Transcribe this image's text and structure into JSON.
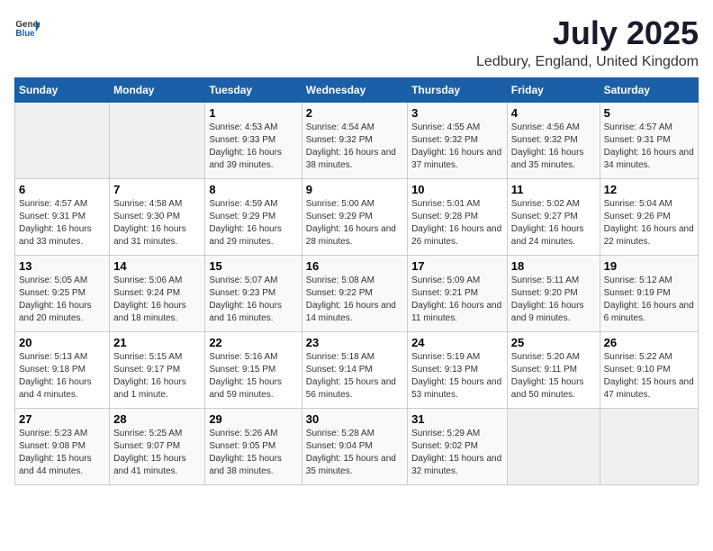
{
  "header": {
    "logo_general": "General",
    "logo_blue": "Blue",
    "title": "July 2025",
    "subtitle": "Ledbury, England, United Kingdom"
  },
  "days_of_week": [
    "Sunday",
    "Monday",
    "Tuesday",
    "Wednesday",
    "Thursday",
    "Friday",
    "Saturday"
  ],
  "weeks": [
    [
      {
        "day": "",
        "detail": ""
      },
      {
        "day": "",
        "detail": ""
      },
      {
        "day": "1",
        "detail": "Sunrise: 4:53 AM\nSunset: 9:33 PM\nDaylight: 16 hours and 39 minutes."
      },
      {
        "day": "2",
        "detail": "Sunrise: 4:54 AM\nSunset: 9:32 PM\nDaylight: 16 hours and 38 minutes."
      },
      {
        "day": "3",
        "detail": "Sunrise: 4:55 AM\nSunset: 9:32 PM\nDaylight: 16 hours and 37 minutes."
      },
      {
        "day": "4",
        "detail": "Sunrise: 4:56 AM\nSunset: 9:32 PM\nDaylight: 16 hours and 35 minutes."
      },
      {
        "day": "5",
        "detail": "Sunrise: 4:57 AM\nSunset: 9:31 PM\nDaylight: 16 hours and 34 minutes."
      }
    ],
    [
      {
        "day": "6",
        "detail": "Sunrise: 4:57 AM\nSunset: 9:31 PM\nDaylight: 16 hours and 33 minutes."
      },
      {
        "day": "7",
        "detail": "Sunrise: 4:58 AM\nSunset: 9:30 PM\nDaylight: 16 hours and 31 minutes."
      },
      {
        "day": "8",
        "detail": "Sunrise: 4:59 AM\nSunset: 9:29 PM\nDaylight: 16 hours and 29 minutes."
      },
      {
        "day": "9",
        "detail": "Sunrise: 5:00 AM\nSunset: 9:29 PM\nDaylight: 16 hours and 28 minutes."
      },
      {
        "day": "10",
        "detail": "Sunrise: 5:01 AM\nSunset: 9:28 PM\nDaylight: 16 hours and 26 minutes."
      },
      {
        "day": "11",
        "detail": "Sunrise: 5:02 AM\nSunset: 9:27 PM\nDaylight: 16 hours and 24 minutes."
      },
      {
        "day": "12",
        "detail": "Sunrise: 5:04 AM\nSunset: 9:26 PM\nDaylight: 16 hours and 22 minutes."
      }
    ],
    [
      {
        "day": "13",
        "detail": "Sunrise: 5:05 AM\nSunset: 9:25 PM\nDaylight: 16 hours and 20 minutes."
      },
      {
        "day": "14",
        "detail": "Sunrise: 5:06 AM\nSunset: 9:24 PM\nDaylight: 16 hours and 18 minutes."
      },
      {
        "day": "15",
        "detail": "Sunrise: 5:07 AM\nSunset: 9:23 PM\nDaylight: 16 hours and 16 minutes."
      },
      {
        "day": "16",
        "detail": "Sunrise: 5:08 AM\nSunset: 9:22 PM\nDaylight: 16 hours and 14 minutes."
      },
      {
        "day": "17",
        "detail": "Sunrise: 5:09 AM\nSunset: 9:21 PM\nDaylight: 16 hours and 11 minutes."
      },
      {
        "day": "18",
        "detail": "Sunrise: 5:11 AM\nSunset: 9:20 PM\nDaylight: 16 hours and 9 minutes."
      },
      {
        "day": "19",
        "detail": "Sunrise: 5:12 AM\nSunset: 9:19 PM\nDaylight: 16 hours and 6 minutes."
      }
    ],
    [
      {
        "day": "20",
        "detail": "Sunrise: 5:13 AM\nSunset: 9:18 PM\nDaylight: 16 hours and 4 minutes."
      },
      {
        "day": "21",
        "detail": "Sunrise: 5:15 AM\nSunset: 9:17 PM\nDaylight: 16 hours and 1 minute."
      },
      {
        "day": "22",
        "detail": "Sunrise: 5:16 AM\nSunset: 9:15 PM\nDaylight: 15 hours and 59 minutes."
      },
      {
        "day": "23",
        "detail": "Sunrise: 5:18 AM\nSunset: 9:14 PM\nDaylight: 15 hours and 56 minutes."
      },
      {
        "day": "24",
        "detail": "Sunrise: 5:19 AM\nSunset: 9:13 PM\nDaylight: 15 hours and 53 minutes."
      },
      {
        "day": "25",
        "detail": "Sunrise: 5:20 AM\nSunset: 9:11 PM\nDaylight: 15 hours and 50 minutes."
      },
      {
        "day": "26",
        "detail": "Sunrise: 5:22 AM\nSunset: 9:10 PM\nDaylight: 15 hours and 47 minutes."
      }
    ],
    [
      {
        "day": "27",
        "detail": "Sunrise: 5:23 AM\nSunset: 9:08 PM\nDaylight: 15 hours and 44 minutes."
      },
      {
        "day": "28",
        "detail": "Sunrise: 5:25 AM\nSunset: 9:07 PM\nDaylight: 15 hours and 41 minutes."
      },
      {
        "day": "29",
        "detail": "Sunrise: 5:26 AM\nSunset: 9:05 PM\nDaylight: 15 hours and 38 minutes."
      },
      {
        "day": "30",
        "detail": "Sunrise: 5:28 AM\nSunset: 9:04 PM\nDaylight: 15 hours and 35 minutes."
      },
      {
        "day": "31",
        "detail": "Sunrise: 5:29 AM\nSunset: 9:02 PM\nDaylight: 15 hours and 32 minutes."
      },
      {
        "day": "",
        "detail": ""
      },
      {
        "day": "",
        "detail": ""
      }
    ]
  ]
}
